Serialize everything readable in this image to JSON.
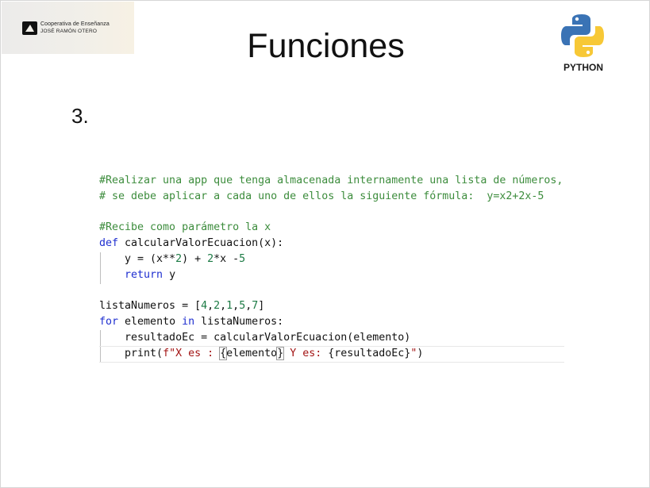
{
  "header": {
    "org_line1": "Cooperativa de Enseñanza",
    "org_line2": "JOSÉ RAMÓN OTERO",
    "title": "Funciones",
    "python_label": "PYTHON"
  },
  "content": {
    "item_number": "3."
  },
  "code": {
    "comment1": "#Realizar una app que tenga almacenada internamente una lista de números,",
    "comment2": "# se debe aplicar a cada uno de ellos la siguiente fórmula:  y=x2+2x-5",
    "comment3": "#Recibe como parámetro la x",
    "def_kw": "def",
    "func_sig": " calcularValorEcuacion(x):",
    "line_y_a": "    y = (x**",
    "num_2a": "2",
    "line_y_b": ") + ",
    "num_2b": "2",
    "line_y_c": "*x -",
    "num_5": "5",
    "return_indent": "    ",
    "return_kw": "return",
    "return_val": " y",
    "lista_a": "listaNumeros = [",
    "lista_nums": [
      "4",
      "2",
      "1",
      "5",
      "7"
    ],
    "lista_b": "]",
    "for_kw": "for",
    "for_var": " elemento ",
    "in_kw": "in",
    "for_iter": " listaNumeros:",
    "assign_line": "    resultadoEc = calcularValorEcuacion(elemento)",
    "print_a": "    print(",
    "fstr_a": "f\"X es : ",
    "brace_open": "{",
    "fvar1": "elemento",
    "brace_close": "}",
    "fstr_b": " Y es: ",
    "fvar2": "{resultadoEc}",
    "fstr_c": "\"",
    "print_b": ")"
  },
  "colors": {
    "comment": "#3c8c3c",
    "keyword": "#1f2fd0",
    "number": "#1b7a44",
    "string": "#a31515",
    "python_blue": "#3a73b5",
    "python_yellow": "#f7c836"
  }
}
